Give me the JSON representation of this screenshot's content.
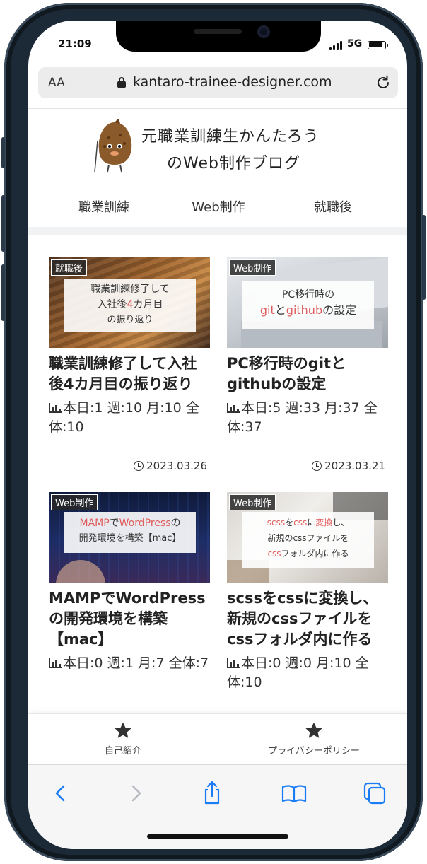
{
  "status_bar": {
    "time": "21:09",
    "network": "5G"
  },
  "browser": {
    "text_size_label": "AA",
    "url": "kantaro-trainee-designer.com"
  },
  "site": {
    "logo_line1": "元職業訓練生かんたろう",
    "logo_line2": "のWeb制作ブログ",
    "nav": [
      "職業訓練",
      "Web制作",
      "就職後"
    ]
  },
  "articles": [
    {
      "category": "就職後",
      "thumb_lines": [
        "職業訓練修了して",
        "入社後4カ月目",
        "の振り返り"
      ],
      "title": "職業訓練修了して入社後4カ月目の振り返り",
      "views": "本日:1 週:10 月:10 全体:10",
      "date": "2023.03.26"
    },
    {
      "category": "Web制作",
      "thumb_lines": [
        "PC移行時の",
        "gitとgithubの設定"
      ],
      "title": "PC移行時のgitとgithubの設定",
      "views": "本日:5 週:33 月:37 全体:37",
      "date": "2023.03.21"
    },
    {
      "category": "Web制作",
      "thumb_lines": [
        "MAMPでWordPressの",
        "開発環境を構築【mac】"
      ],
      "title": "MAMPでWordPressの開発環境を構築【mac】",
      "views": "本日:0 週:1 月:7 全体:7",
      "date": ""
    },
    {
      "category": "Web制作",
      "thumb_lines": [
        "scssをcssに変換し、",
        "新規のcssファイルを",
        "cssフォルダ内に作る"
      ],
      "title": "scssをcssに変換し、新規のcssファイルをcssフォルダ内に作る",
      "views": "本日:0 週:0 月:10 全体:10",
      "date": ""
    }
  ],
  "footer_menu": [
    {
      "label": "自己紹介",
      "icon": "star-icon"
    },
    {
      "label": "プライバシーポリシー",
      "icon": "star-icon"
    }
  ],
  "toolbar": {
    "accent": "#1a7cf5",
    "buttons": [
      "back-icon",
      "forward-icon",
      "share-icon",
      "bookmarks-icon",
      "tabs-icon"
    ]
  }
}
